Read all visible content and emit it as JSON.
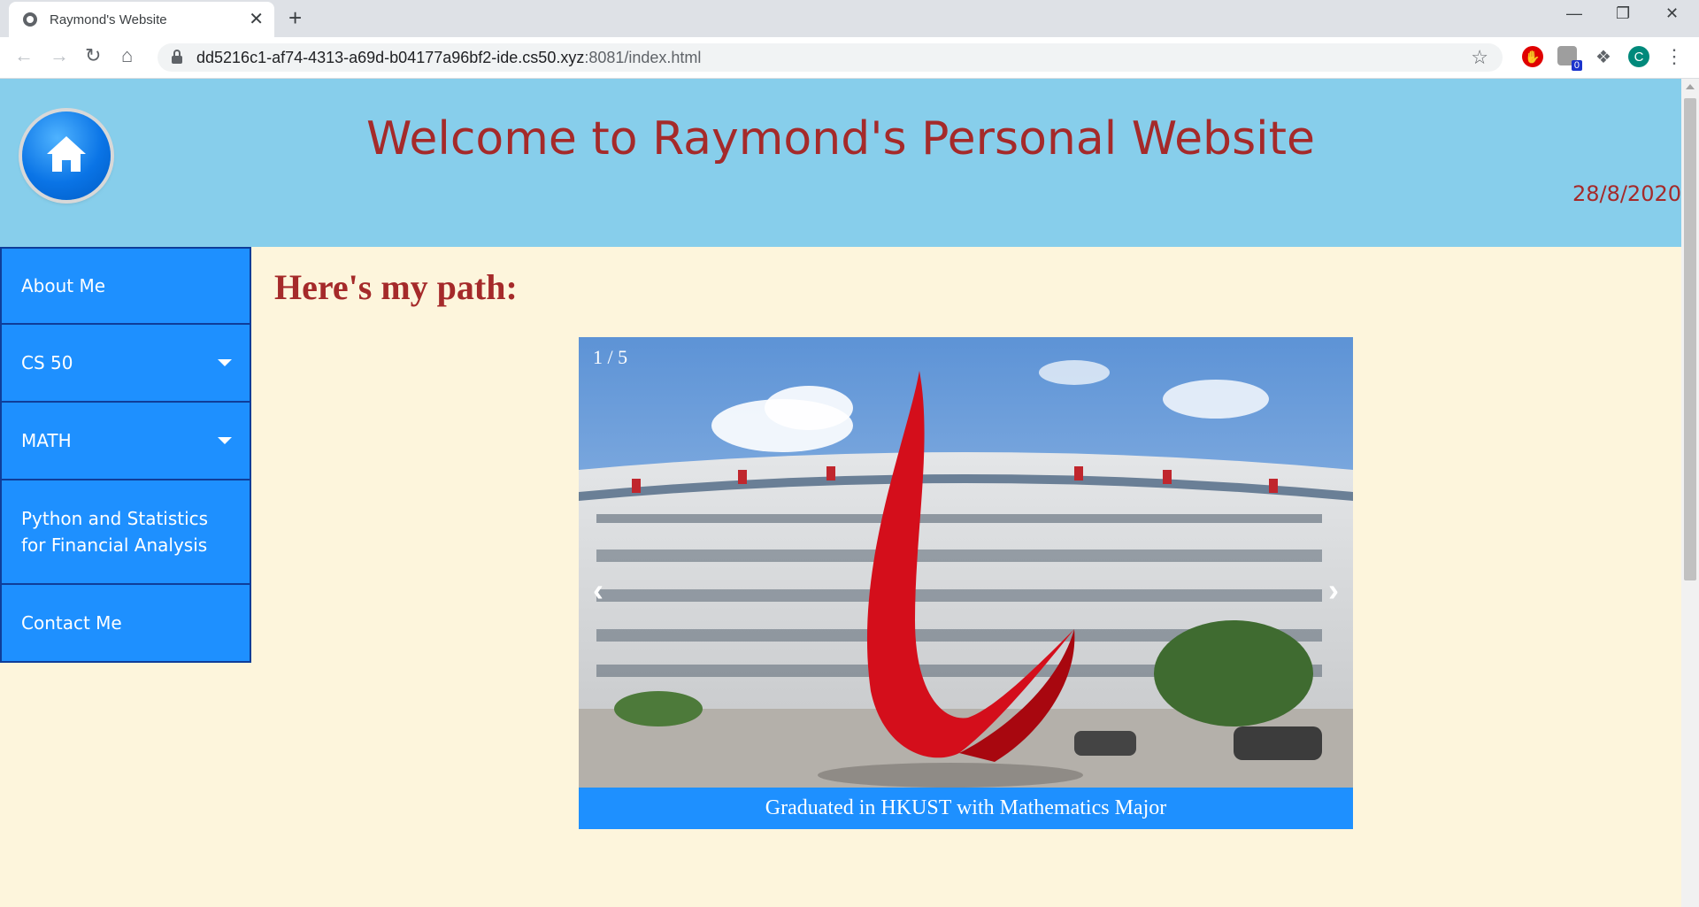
{
  "browser": {
    "tab_title": "Raymond's Website",
    "tab_close": "✕",
    "new_tab": "+",
    "url_host": "dd5216c1-af74-4313-a69d-b04177a96bf2-ide.cs50.xyz",
    "url_rest": ":8081/index.html",
    "ext_badge": "0",
    "profile_initial": "C"
  },
  "header": {
    "title": "Welcome to Raymond's Personal Website",
    "date": "28/8/2020"
  },
  "sidebar": {
    "items": [
      {
        "label": "About Me"
      },
      {
        "label": "CS 50"
      },
      {
        "label": "MATH"
      },
      {
        "label": "Python and Statistics for Financial Analysis"
      },
      {
        "label": "Contact Me"
      }
    ]
  },
  "main": {
    "heading": "Here's my path:"
  },
  "slideshow": {
    "counter": "1 / 5",
    "caption": "Graduated in HKUST with Mathematics Major",
    "prev": "‹",
    "next": "›",
    "total": 5,
    "active_index": 0
  },
  "colors": {
    "header_bg": "#87ceeb",
    "page_bg": "#fdf5dc",
    "accent": "#1e90ff",
    "title_text": "#a52a2a"
  }
}
